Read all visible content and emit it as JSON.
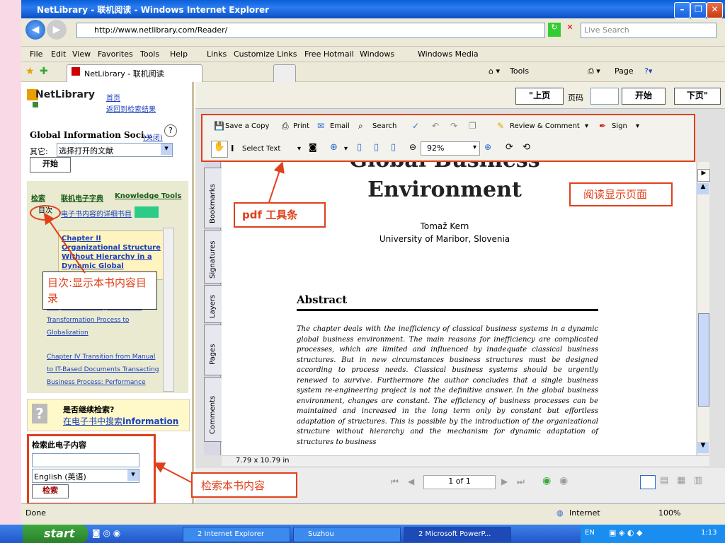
{
  "window": {
    "title": "NetLibrary - 联机阅读 - Windows Internet Explorer"
  },
  "address": {
    "url": "http://www.netlibrary.com/Reader/",
    "search_placeholder": "Live Search"
  },
  "menu": {
    "items": [
      "File",
      "Edit",
      "View",
      "Favorites",
      "Tools",
      "Help"
    ]
  },
  "links_bar": {
    "label": "Links",
    "items": [
      "Customize Links",
      "Free Hotmail",
      "Windows",
      "Windows Media"
    ]
  },
  "tab": {
    "title": "NetLibrary - 联机阅读"
  },
  "command_bar": {
    "tools_label": "Tools",
    "page_label": "Page"
  },
  "left_panel": {
    "logo": "NetLibrary",
    "home_link": "首页",
    "back_link": "返回到检索结果",
    "book_title": "Global Information Soci...",
    "close_link": "(关闭)",
    "other_label": "其它:",
    "other_select": "选择打开的文献",
    "start_button": "开始",
    "tabs": [
      "检索",
      "联机电子字典",
      "Knowledge Tools"
    ],
    "subtabs": [
      "目次",
      "电子书内容的详细书目"
    ],
    "toc_first": "Chapter II Organizational Structure Without Hierarchy in a Dynamic Global Business Environment",
    "toc_items": [
      "Chapter III The Organizational Transformation Process to Globalization",
      "Chapter IV Transition from Manual to IT-Based Documents Transacting Business Process: Performance"
    ],
    "continue_title": "是否继续检索?",
    "continue_link_prefix": "在电子书中搜索",
    "continue_link_word": "information",
    "search_heading": "检索此电子内容",
    "language_select": "English (英语)",
    "search_button": "检索"
  },
  "viewer": {
    "prev_button": "\"上页",
    "page_label": "页码",
    "go_button": "开始",
    "next_button": "下页\"",
    "toolbar": {
      "save": "Save a Copy",
      "print": "Print",
      "email": "Email",
      "search": "Search",
      "review": "Review & Comment",
      "sign": "Sign",
      "select_text": "Select Text",
      "zoom": "92%"
    },
    "side_tabs": [
      "Bookmarks",
      "Signatures",
      "Layers",
      "Pages",
      "Comments"
    ],
    "doc": {
      "title_line1": "Global Business",
      "title_line2": "Environment",
      "author": "Tomaž Kern",
      "affiliation": "University of Maribor, Slovenia",
      "abstract_heading": "Abstract",
      "abstract_text": "The chapter deals with the inefficiency of classical business systems in a dynamic global business environment. The main reasons for inefficiency are complicated processes, which are limited and influenced by inadequate classical business structures. But in new circumstances business structures must be designed according to process needs. Classical business systems should be urgently renewed to survive. Furthermore the author concludes that a single business system re-engineering project is not the definitive answer. In the global business environment, changes are constant. The efficiency of business processes can be maintained and increased in the long term only by constant but effortless adaptation of structures. This is possible by the introduction of the organizational structure without hierarchy and the mechanism for dynamic adaptation of structures to business"
    },
    "page_size": "7.79 x 10.79 in",
    "page_indicator": "1 of 1"
  },
  "annotations": {
    "toolbar_note": "pdf 工具条",
    "reading_note": "阅读显示页面",
    "toc_note": "目次:显示本书内容目录",
    "search_note": "检索本书内容"
  },
  "status": {
    "left": "Done",
    "zone": "Internet",
    "zoom": "100%"
  },
  "taskbar": {
    "start": "start",
    "items": [
      "2 Internet Explorer",
      "Suzhou",
      "2 Microsoft PowerP..."
    ],
    "lang": "EN",
    "clock": "1:13"
  },
  "colors": {
    "annotation": "#e0401a",
    "titlebar": "#0a5fd8",
    "background": "#f9d9e6"
  }
}
